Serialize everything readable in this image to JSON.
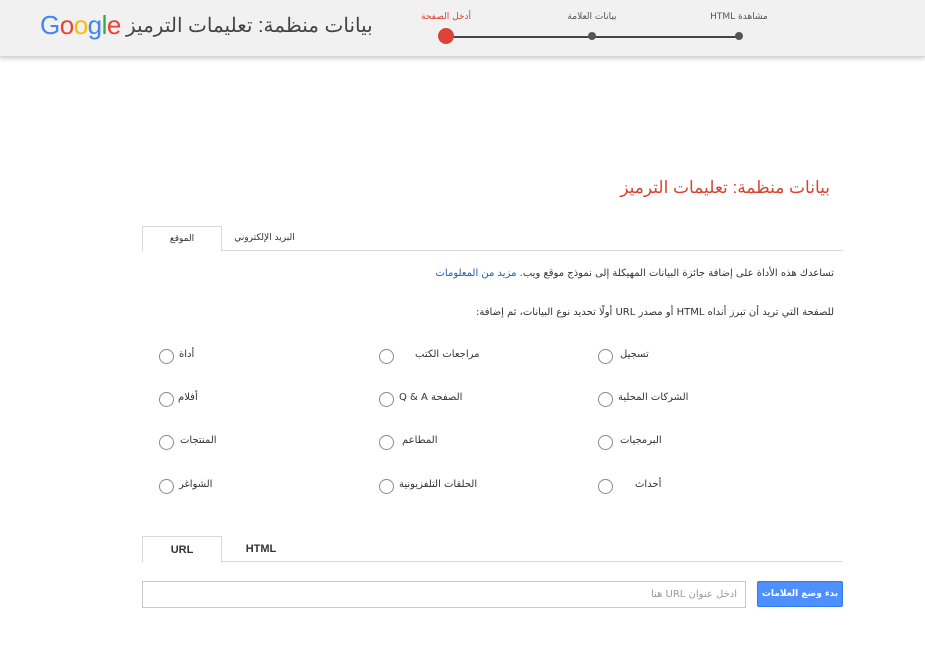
{
  "header": {
    "logo": {
      "letters": [
        "G",
        "o",
        "o",
        "g",
        "l",
        "e"
      ],
      "colors": [
        "#4285f4",
        "#ea4335",
        "#fbbc05",
        "#4285f4",
        "#34a853",
        "#ea4335"
      ]
    },
    "title": "بيانات منظمة: تعليمات الترميز",
    "steps": [
      {
        "label": "أدخل الصفحة",
        "active": true
      },
      {
        "label": "بيانات العلامة",
        "active": false
      },
      {
        "label": "HTML مشاهدة",
        "active": false
      }
    ]
  },
  "main": {
    "title": "بيانات منظمة: تعليمات الترميز",
    "tabs": [
      {
        "label": "الموقع",
        "active": true
      },
      {
        "label": "البريد الإلكتروني",
        "active": false
      }
    ],
    "description": "تساعدك هذه الأداة على إضافة جائزة البيانات المهيكلة إلى نموذج موقع ويب.",
    "learn_more": "مزيد من المعلومات",
    "instructions": "للصفحة التي تريد أن تبرز أنداه HTML أو مصدر URL أولًا تحديد نوع البيانات، ثم إضافة:",
    "data_types": [
      [
        "تسجيل",
        "مراجعات الكتب",
        "أداة"
      ],
      [
        "الشركات المحلية",
        "الصفحة Q & A",
        "أفلام"
      ],
      [
        "البرمجيات",
        "المطاعم",
        "المنتجات"
      ],
      [
        "أحداث",
        "الحلقات التلفزيونية",
        "الشواغر"
      ]
    ],
    "source_tabs": [
      {
        "label": "URL",
        "active": true
      },
      {
        "label": "HTML",
        "active": false
      }
    ],
    "url_placeholder": "أدخل عنوان URL هنا",
    "start_button": "بدء وضع العلامات"
  }
}
